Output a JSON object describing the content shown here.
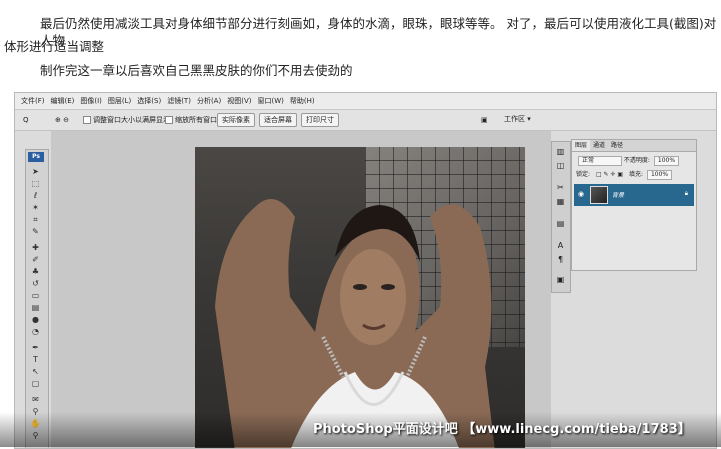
{
  "article": {
    "paragraph1_line1": "最后仍然使用减淡工具对身体细节部分进行刻画如，身体的水滴，眼珠，眼球等等。 对了，最后可以使用液化工具(截图)对人物",
    "paragraph1_line2": "体形进行适当调整",
    "paragraph2": "制作完这一章以后喜欢自己黑黑皮肤的你们不用去使劲的"
  },
  "menubar": {
    "items": [
      "文件(F)",
      "编辑(E)",
      "图像(I)",
      "图层(L)",
      "选择(S)",
      "滤镜(T)",
      "分析(A)",
      "视图(V)",
      "窗口(W)",
      "帮助(H)"
    ]
  },
  "optionsbar": {
    "zoom_symbol": "Q",
    "check1": "调整窗口大小以满屏显示",
    "check2": "缩放所有窗口",
    "btn_actual": "实际像素",
    "btn_fit": "适合屏幕",
    "btn_print": "打印尺寸",
    "workspace": "工作区 ▾"
  },
  "toolbox": {
    "logo": "Ps"
  },
  "layers_panel": {
    "tabs": [
      "图层",
      "通道",
      "路径"
    ],
    "blend_mode": "正常",
    "opacity_label": "不透明度:",
    "opacity_value": "100%",
    "lock_label": "锁定:",
    "fill_label": "填充:",
    "fill_value": "100%",
    "layer_name": "背景"
  },
  "watermark": "PhotoShop平面设计吧 【www.linecg.com/tieba/1783】"
}
